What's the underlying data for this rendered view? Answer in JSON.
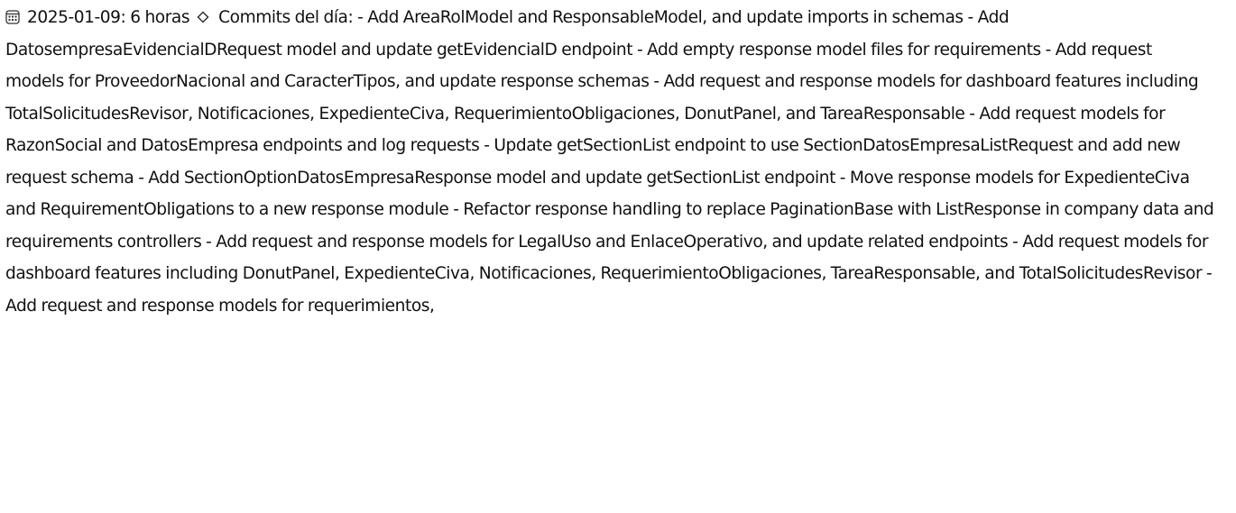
{
  "entry": {
    "icon": "calendar-icon",
    "date_label": "2025-01-09: 6 horas",
    "separator_icon": "diamond-outline-icon",
    "commits_text": "Commits del día: - Add AreaRolModel and ResponsableModel, and update imports in schemas - Add DatosempresaEvidencialDRequest model and update getEvidencialD endpoint - Add empty response model files for requirements - Add request models for ProveedorNacional and CaracterTipos, and update response schemas - Add request and response models for dashboard features including TotalSolicitudesRevisor, Notificaciones, ExpedienteCiva, RequerimientoObligaciones, DonutPanel, and TareaResponsable - Add request models for RazonSocial and DatosEmpresa endpoints and log requests - Update getSectionList endpoint to use SectionDatosEmpresaListRequest and add new request schema - Add SectionOptionDatosEmpresaResponse model and update getSectionList endpoint - Move response models for ExpedienteCiva and RequirementObligations to a new response module - Refactor response handling to replace PaginationBase with ListResponse in company data and requirements controllers - Add request and response models for LegalUso and EnlaceOperativo, and update related endpoints - Add request models for dashboard features including DonutPanel, ExpedienteCiva, Notificaciones, RequerimientoObligaciones, TareaResponsable, and TotalSolicitudesRevisor - Add request and response models for requerimientos,"
  }
}
